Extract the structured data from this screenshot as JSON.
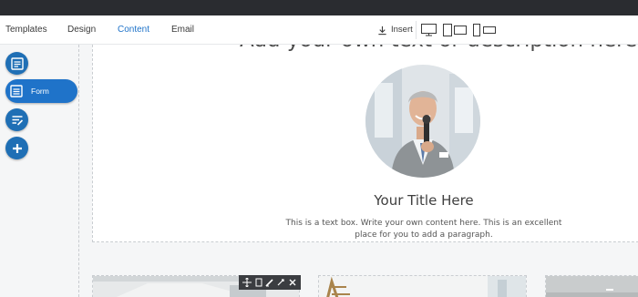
{
  "menubar": {
    "items": [
      {
        "label": "Templates",
        "active": false
      },
      {
        "label": "Design",
        "active": false
      },
      {
        "label": "Content",
        "active": true
      },
      {
        "label": "Email",
        "active": false
      }
    ],
    "insert_label": "Insert"
  },
  "sidebar": {
    "form_label": "Form"
  },
  "content": {
    "headline": "Add your own text or description here",
    "title": "Your Title Here",
    "body": "This is a text box. Write your own content here. This is an excellent place for you to add a paragraph."
  },
  "colors": {
    "accent": "#1f73c9",
    "topbar": "#2a2c30"
  }
}
